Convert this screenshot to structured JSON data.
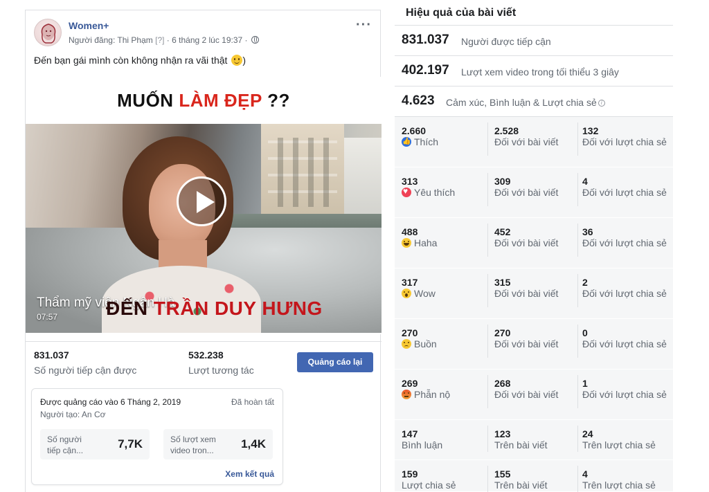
{
  "post": {
    "page_name": "Women+",
    "meta_prefix": "Người đăng:",
    "author": "Thi Phạm",
    "author_q": "[?]",
    "time": "· 6 tháng 2 lúc 19:37 ·",
    "text": "Đến bạn gái mình còn không nhận ra vãi thật",
    "text_suffix": ")",
    "video": {
      "banner_left": "MUỐN ",
      "banner_highlight": "LÀM ĐẸP",
      "banner_right": " ??",
      "overlay_title": "Thẩm mỹ viện Ngân Hà",
      "caption_dark": "ĐẾN ",
      "caption_red": "TRẦN DUY HƯNG",
      "duration": "07:57",
      "progress": 0
    },
    "stats": {
      "reach_value": "831.037",
      "reach_label": "Số người tiếp cận được",
      "engagement_value": "532.238",
      "engagement_label": "Lượt tương tác",
      "boost_again_label": "Quảng cáo lại"
    },
    "boost": {
      "title": "Được quảng cáo vào 6 Tháng 2, 2019",
      "status": "Đã hoàn tất",
      "creator": "Người tạo: An Cơ",
      "box1_label": "Số người tiếp cận...",
      "box1_value": "7,7K",
      "box2_label": "Số lượt xem video tron...",
      "box2_value": "1,4K",
      "view_results": "Xem kết quả"
    }
  },
  "insights": {
    "title": "Hiệu quả của bài viết",
    "metrics": [
      {
        "value": "831.037",
        "label": "Người được tiếp cận"
      },
      {
        "value": "402.197",
        "label": "Lượt xem video trong tối thiểu 3 giây"
      },
      {
        "value": "4.623",
        "label": "Cảm xúc, Bình luận & Lượt chia sẻ"
      }
    ],
    "rows": [
      {
        "total": "2.660",
        "name": "Thích",
        "icon": "like-icon",
        "post": "2.528",
        "post_label": "Đối với bài viết",
        "share": "132",
        "share_label": "Đối với lượt chia sẻ"
      },
      {
        "total": "313",
        "name": "Yêu thích",
        "icon": "love-icon",
        "post": "309",
        "post_label": "Đối với bài viết",
        "share": "4",
        "share_label": "Đối với lượt chia sẻ"
      },
      {
        "total": "488",
        "name": "Haha",
        "icon": "haha-icon",
        "post": "452",
        "post_label": "Đối với bài viết",
        "share": "36",
        "share_label": "Đối với lượt chia sẻ"
      },
      {
        "total": "317",
        "name": "Wow",
        "icon": "wow-icon",
        "post": "315",
        "post_label": "Đối với bài viết",
        "share": "2",
        "share_label": "Đối với lượt chia sẻ"
      },
      {
        "total": "270",
        "name": "Buồn",
        "icon": "sad-icon",
        "post": "270",
        "post_label": "Đối với bài viết",
        "share": "0",
        "share_label": "Đối với lượt chia sẻ"
      },
      {
        "total": "269",
        "name": "Phẫn nộ",
        "icon": "angry-icon",
        "post": "268",
        "post_label": "Đối với bài viết",
        "share": "1",
        "share_label": "Đối với lượt chia sẻ"
      },
      {
        "total": "147",
        "name": "Bình luận",
        "icon": "",
        "post": "123",
        "post_label": "Trên bài viết",
        "share": "24",
        "share_label": "Trên lượt chia sẻ"
      },
      {
        "total": "159",
        "name": "Lượt chia sẻ",
        "icon": "",
        "post": "155",
        "post_label": "Trên bài viết",
        "share": "4",
        "share_label": "Trên lượt chia sẻ"
      }
    ]
  },
  "colors": {
    "link": "#385898",
    "button": "#4267b2",
    "panel_bg": "#f5f6f7",
    "highlight_red": "#d9261c"
  }
}
